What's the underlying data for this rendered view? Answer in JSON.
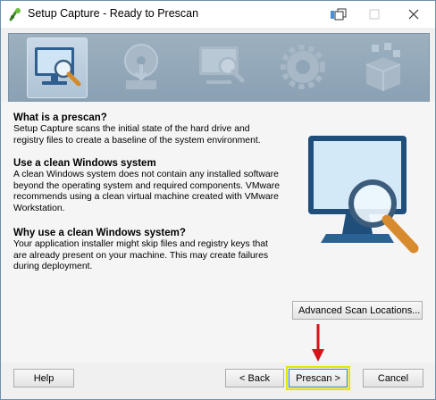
{
  "window": {
    "title": "Setup Capture - Ready to Prescan"
  },
  "wizard_steps": [
    "prescan-step-icon",
    "install-step-icon",
    "postscan-step-icon",
    "configure-step-icon",
    "package-step-icon"
  ],
  "content": {
    "sections": [
      {
        "heading": "What is a prescan?",
        "text": "Setup Capture scans the initial state of the hard drive and registry files to create a baseline of the system environment."
      },
      {
        "heading": "Use a clean Windows system",
        "text": "A clean Windows system does not contain any installed software beyond the operating system and required components. VMware recommends using a clean virtual machine created with VMware Workstation."
      },
      {
        "heading": "Why use a clean Windows system?",
        "text": "Your application installer might skip files and registry keys that are already present on your machine. This may create failures during deployment."
      }
    ]
  },
  "buttons": {
    "advanced": "Advanced Scan Locations...",
    "help": "Help",
    "back": "< Back",
    "prescan": "Prescan >",
    "cancel": "Cancel"
  },
  "colors": {
    "banner": "#8fa5b8",
    "highlight": "#e8e400",
    "arrow": "#d9121a"
  }
}
